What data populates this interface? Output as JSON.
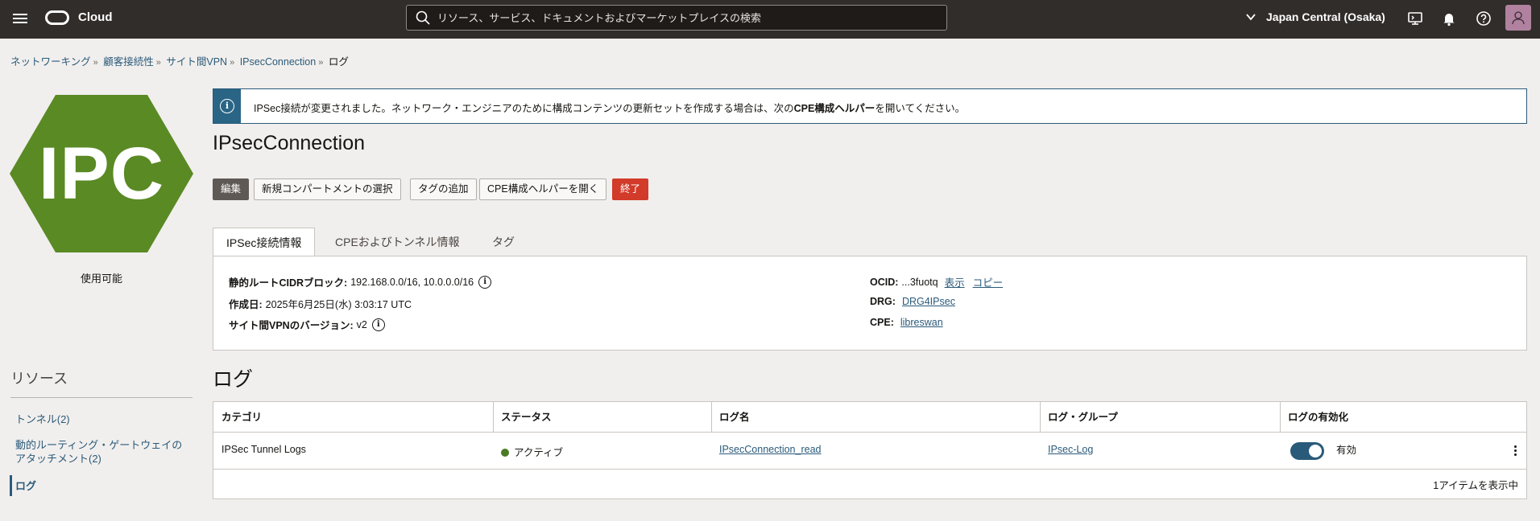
{
  "header": {
    "brand": "Cloud",
    "search_placeholder": "リソース、サービス、ドキュメントおよびマーケットプレイスの検索",
    "region": "Japan Central (Osaka)",
    "icons": [
      "hamburger-icon",
      "oracle-logo",
      "search-icon",
      "chevron-down-icon",
      "cloud-shell-icon",
      "bell-icon",
      "help-icon",
      "user-icon"
    ]
  },
  "breadcrumb": {
    "items": [
      "ネットワーキング",
      "顧客接続性",
      "サイト間VPN",
      "IPsecConnection"
    ],
    "current": "ログ",
    "separator": "»"
  },
  "resource_icon": {
    "text": "IPC",
    "color": "#5a8a24"
  },
  "status": "使用可能",
  "resources": {
    "title": "リソース",
    "items": [
      "トンネル(2)",
      "動的ルーティング・ゲートウェイの",
      "アタッチメント(2)",
      "ログ"
    ]
  },
  "banner": {
    "text_before": "IPSec接続が変更されました。ネットワーク・エンジニアのために構成コンテンツの更新セットを作成する場合は、次の",
    "bold": "CPE構成ヘルパー",
    "text_after": "を開いてください。"
  },
  "title": "IPsecConnection",
  "actions": {
    "edit": "編集",
    "move": "新規コンパートメントの選択",
    "tags": "タグの追加",
    "cpe_helper": "CPE構成ヘルパーを開く",
    "terminate": "終了"
  },
  "tabs": [
    "IPSec接続情報",
    "CPEおよびトンネル情報",
    "タグ"
  ],
  "details": {
    "static_routes_label": "静的ルートCIDRブロック:",
    "static_routes_value": "192.168.0.0/16, 10.0.0.0/16",
    "created_label": "作成日:",
    "created_value": "2025年6月25日(水) 3:03:17 UTC",
    "vpn_version_label": "サイト間VPNのバージョン:",
    "vpn_version_value": "v2",
    "ocid_label": "OCID:",
    "ocid_value": "...3fuotq",
    "ocid_show": "表示",
    "ocid_copy": "コピー",
    "drg_label": "DRG:",
    "drg_value": "DRG4IPsec",
    "cpe_label": "CPE:",
    "cpe_value": "libreswan",
    "info_glyph": "i"
  },
  "logs": {
    "title": "ログ",
    "columns": [
      "カテゴリ",
      "ステータス",
      "ログ名",
      "ログ・グループ",
      "ログの有効化"
    ],
    "rows": [
      {
        "category": "IPSec Tunnel Logs",
        "status": "アクティブ",
        "log_name": "IPsecConnection_read",
        "log_group": "IPsec-Log",
        "enabled": true,
        "enabled_label": "有効"
      }
    ],
    "footer": "1アイテムを表示中"
  },
  "colors": {
    "topbar": "#312d2a",
    "accent": "#2a5a7a",
    "danger": "#d23a29",
    "hex": "#5a8a24",
    "status_active": "#4b7a25"
  }
}
